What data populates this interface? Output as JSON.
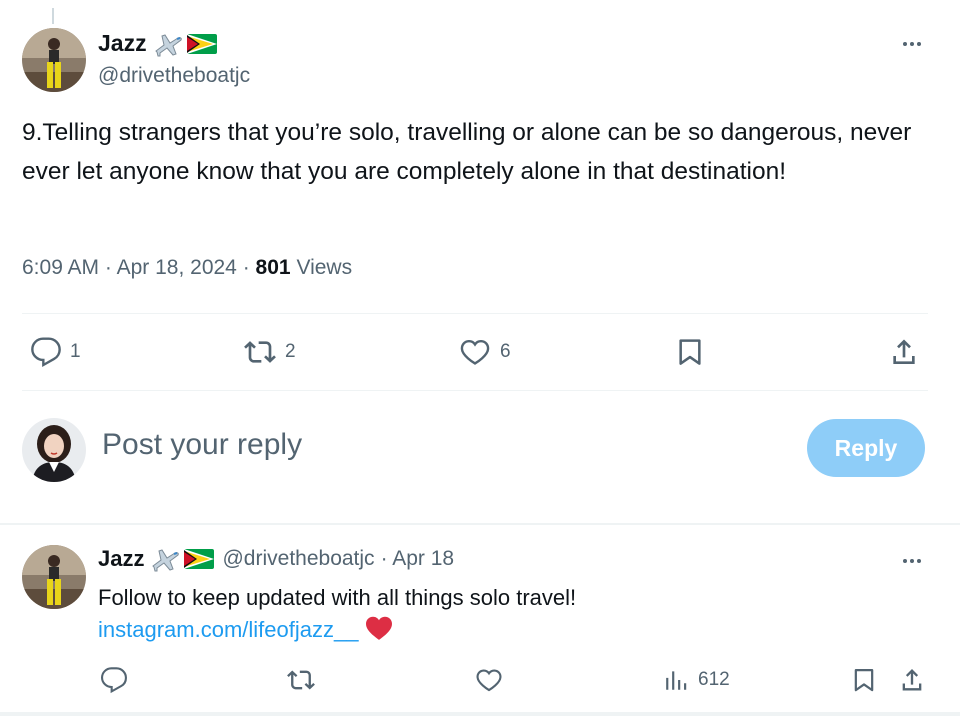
{
  "main_tweet": {
    "author_name": "Jazz",
    "author_handle": "@drivetheboatjc",
    "text": "9.Telling strangers that you’re solo, travelling or alone can be so dangerous, never ever let anyone know that you are completely alone in that destination!",
    "time": "6:09 AM",
    "date": "Apr 18, 2024",
    "views_count": "801",
    "views_label": "Views",
    "separator": "·",
    "actions": {
      "replies": "1",
      "reposts": "2",
      "likes": "6"
    }
  },
  "compose": {
    "placeholder": "Post your reply",
    "reply_button": "Reply"
  },
  "reply_tweet": {
    "author_name": "Jazz",
    "author_handle": "@drivetheboatjc",
    "date": "· Apr 18",
    "text": "Follow to keep updated with all things solo travel!",
    "link": "instagram.com/lifeofjazz__",
    "actions": {
      "views": "612"
    }
  },
  "icons": {
    "more": "more-horizontal-icon",
    "reply": "speech-bubble-icon",
    "repost": "repost-arrows-icon",
    "like": "heart-outline-icon",
    "bookmark": "bookmark-icon",
    "share": "share-upload-icon",
    "views": "bar-chart-icon",
    "airplane": "airplane-emoji-icon",
    "flag": "guyana-flag-emoji-icon",
    "heart": "red-heart-emoji-icon"
  },
  "colors": {
    "text_primary": "#0f1419",
    "text_secondary": "#536471",
    "link": "#1d9bf0",
    "reply_button_disabled": "#8ecdf8",
    "divider": "#eff3f4"
  }
}
